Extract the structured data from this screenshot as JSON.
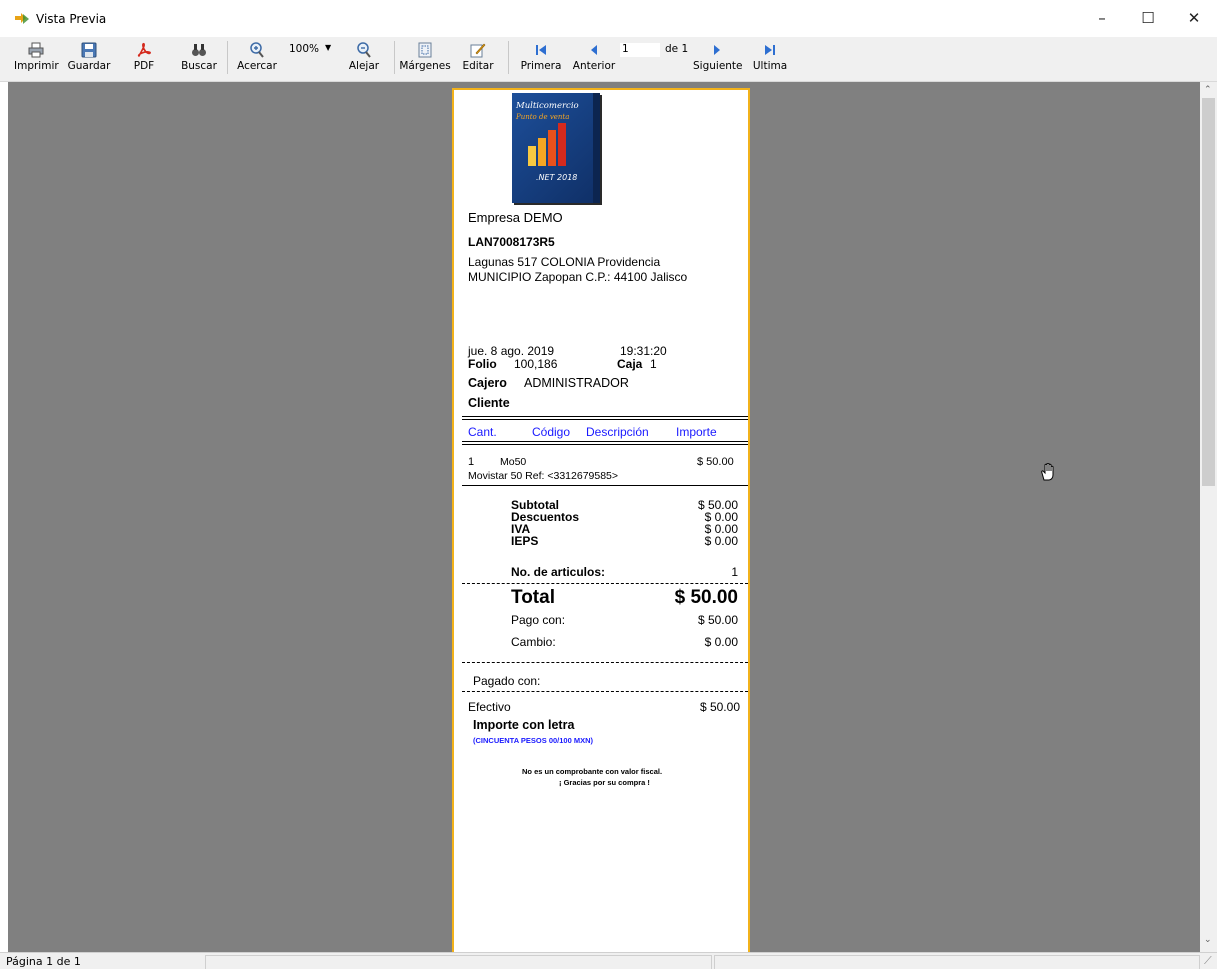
{
  "window": {
    "title": "Vista Previa",
    "minimize": "–",
    "maximize": "☐",
    "close": "✕"
  },
  "toolbar": {
    "imprimir": "Imprimir",
    "guardar": "Guardar",
    "pdf": "PDF",
    "buscar": "Buscar",
    "acercar": "Acercar",
    "zoom": "100%",
    "alejar": "Alejar",
    "margenes": "Márgenes",
    "editar": "Editar",
    "primera": "Primera",
    "anterior": "Anterior",
    "page_value": "1",
    "page_of": "de 1",
    "siguiente": "Siguiente",
    "ultima": "Ultima"
  },
  "logo": {
    "line1": "Multicomercio",
    "line2": "Punto de venta",
    "version": ".NET 2018"
  },
  "receipt": {
    "empresa": "Empresa DEMO",
    "rfc": "LAN7008173R5",
    "address1": "Lagunas 517  COLONIA Providencia",
    "address2": "MUNICIPIO Zapopan C.P.: 44100 Jalisco",
    "date": "jue. 8 ago. 2019",
    "time": "19:31:20",
    "folio_label": "Folio",
    "folio_value": "100,186",
    "caja_label": "Caja",
    "caja_value": "1",
    "cajero_label": "Cajero",
    "cajero_value": "ADMINISTRADOR",
    "cliente_label": "Cliente",
    "columns": {
      "cant": "Cant.",
      "codigo": "Código",
      "descripcion": "Descripción",
      "importe": "Importe"
    },
    "item": {
      "qty": "1",
      "code": "Mo50",
      "amount": "$ 50.00",
      "description": "Movistar 50 Ref: <3312679585>"
    },
    "totals": {
      "subtotal_label": "Subtotal",
      "subtotal": "$ 50.00",
      "descuentos_label": "Descuentos",
      "descuentos": "$ 0.00",
      "iva_label": "IVA",
      "iva": "$ 0.00",
      "ieps_label": "IEPS",
      "ieps": "$ 0.00",
      "articulos_label": "No. de articulos:",
      "articulos": "1",
      "total_label": "Total",
      "total": "$ 50.00",
      "pago_label": "Pago con:",
      "pago": "$ 50.00",
      "cambio_label": "Cambio:",
      "cambio": "$ 0.00"
    },
    "pagado_label": "Pagado con:",
    "efectivo_label": "Efectivo",
    "efectivo": "$ 50.00",
    "letra_label": "Importe con letra",
    "letra_value": "(CINCUENTA PESOS 00/100 MXN)",
    "footer1": "No es un comprobante con valor fiscal.",
    "footer2": "¡ Gracias por su compra !"
  },
  "status": {
    "page": "Página 1 de 1"
  },
  "colors": {
    "accent_border": "#f2b21b",
    "link_blue": "#1a1aff",
    "workspace": "#808080"
  }
}
